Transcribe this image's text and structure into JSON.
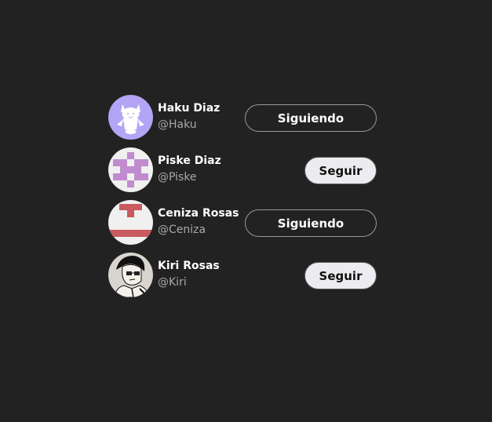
{
  "users": [
    {
      "name": "Haku Diaz",
      "handle": "@Haku",
      "button": "Siguiendo",
      "following": true,
      "avatar": "white-fox-on-purple-avatar"
    },
    {
      "name": "Piske Diaz",
      "handle": "@Piske",
      "button": "Seguir",
      "following": false,
      "avatar": "purple-pixel-pattern-avatar"
    },
    {
      "name": "Ceniza Rosas",
      "handle": "@Ceniza",
      "button": "Siguiendo",
      "following": true,
      "avatar": "red-pixel-pattern-avatar"
    },
    {
      "name": "Kiri Rosas",
      "handle": "@Kiri",
      "button": "Seguir",
      "following": false,
      "avatar": "manga-character-avatar"
    }
  ],
  "colors": {
    "background": "#222222",
    "purple": "#b3a4f5",
    "pixel_purple": "#c08ccf",
    "pixel_red": "#c85a60"
  }
}
